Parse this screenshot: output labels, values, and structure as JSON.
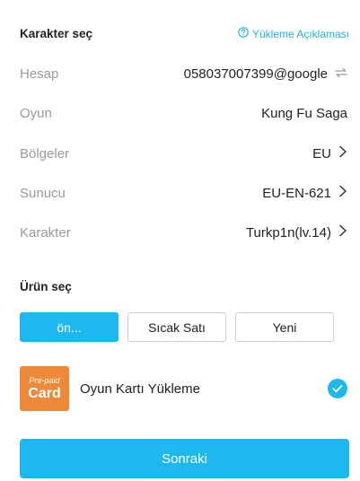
{
  "character_section": {
    "title": "Karakter seç",
    "help_link": "Yükleme Açıklaması"
  },
  "fields": [
    {
      "label": "Hesap",
      "value": "058037007399@google",
      "icon": "swap-icon"
    },
    {
      "label": "Oyun",
      "value": "Kung Fu Saga",
      "icon": ""
    },
    {
      "label": "Bölgeler",
      "value": "EU",
      "icon": "chevron-right-icon"
    },
    {
      "label": "Sunucu",
      "value": "EU-EN-621",
      "icon": "chevron-right-icon"
    },
    {
      "label": "Karakter",
      "value": "Turkp1n(lv.14)",
      "icon": "chevron-right-icon"
    }
  ],
  "product_section": {
    "title": "Ürün seç",
    "tabs": [
      {
        "label": "ön...",
        "active": true
      },
      {
        "label": "Sıcak Satı",
        "active": false
      },
      {
        "label": "Yeni",
        "active": false
      }
    ],
    "item": {
      "image_text_top": "Pre-paid",
      "image_text_main": "Card",
      "name": "Oyun Kartı Yükleme",
      "selected": true
    }
  },
  "next_button": {
    "label": "Sonraki"
  },
  "colors": {
    "accent": "#1fb8ee",
    "card": "#ec8a3a",
    "label_gray": "#9a9a9a"
  }
}
